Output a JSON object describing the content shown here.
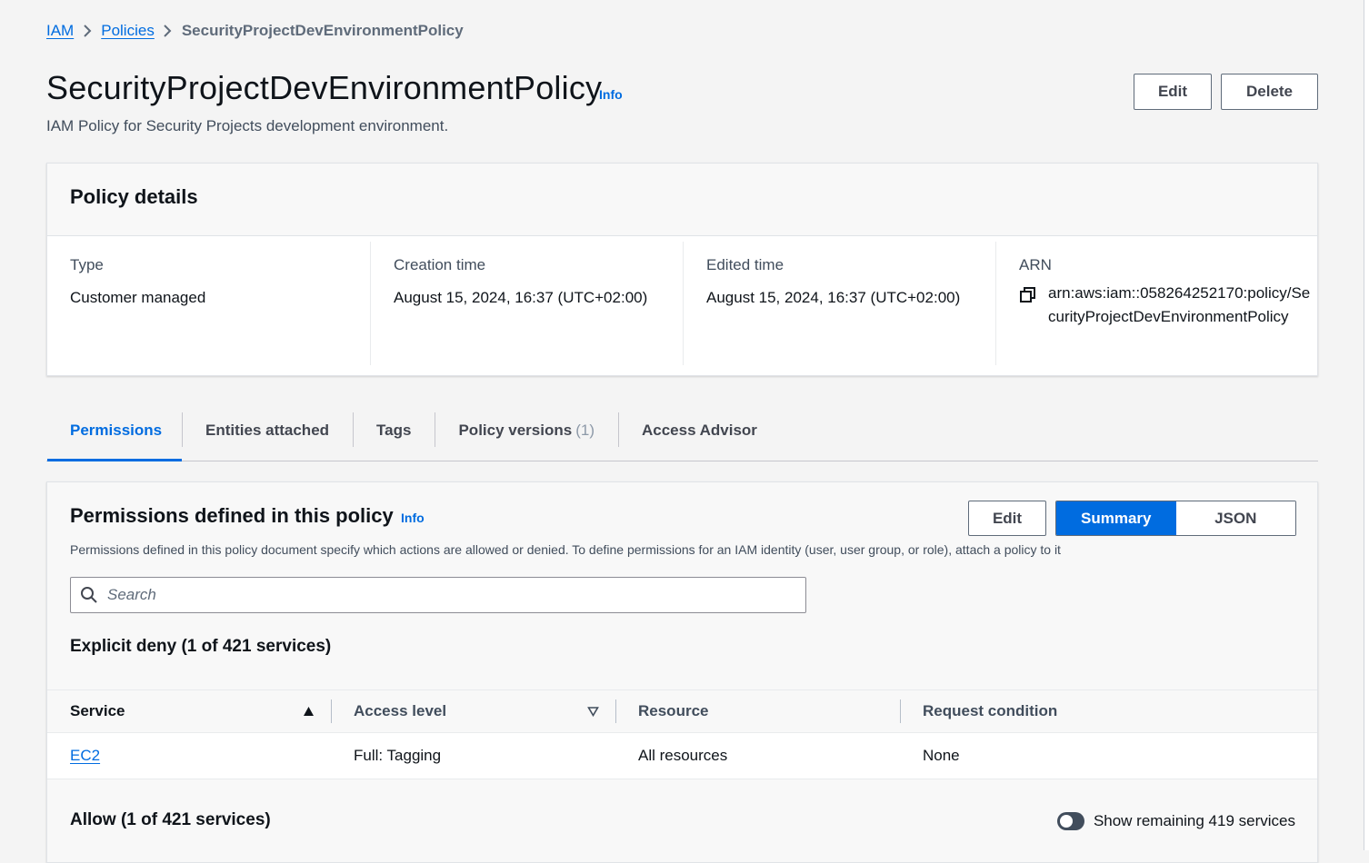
{
  "breadcrumb": {
    "items": [
      "IAM",
      "Policies"
    ],
    "current": "SecurityProjectDevEnvironmentPolicy"
  },
  "header": {
    "title": "SecurityProjectDevEnvironmentPolicy",
    "info": "Info",
    "description": "IAM Policy for Security Projects development environment.",
    "edit_label": "Edit",
    "delete_label": "Delete"
  },
  "details": {
    "title": "Policy details",
    "type_label": "Type",
    "type_value": "Customer managed",
    "creation_label": "Creation time",
    "creation_value": "August 15, 2024, 16:37 (UTC+02:00)",
    "edited_label": "Edited time",
    "edited_value": "August 15, 2024, 16:37 (UTC+02:00)",
    "arn_label": "ARN",
    "arn_value": "arn:aws:iam::058264252170:policy/SecurityProjectDevEnvironmentPolicy"
  },
  "tabs": {
    "permissions": "Permissions",
    "entities": "Entities attached",
    "tags": "Tags",
    "versions": "Policy versions",
    "versions_count": "(1)",
    "advisor": "Access Advisor"
  },
  "permissions": {
    "title": "Permissions defined in this policy",
    "info": "Info",
    "description": "Permissions defined in this policy document specify which actions are allowed or denied. To define permissions for an IAM identity (user, user group, or role), attach a policy to it",
    "edit_label": "Edit",
    "summary_label": "Summary",
    "json_label": "JSON",
    "search_placeholder": "Search",
    "deny_heading": "Explicit deny (1 of 421 services)",
    "columns": [
      "Service",
      "Access level",
      "Resource",
      "Request condition"
    ],
    "rows": [
      {
        "service": "EC2",
        "access": "Full: Tagging",
        "resource": "All resources",
        "condition": "None"
      }
    ],
    "allow_heading": "Allow (1 of 421 services)",
    "toggle_label": "Show remaining 419 services"
  },
  "colors": {
    "accent": "#006ce0",
    "text": "#0f141a",
    "muted": "#414d5c"
  }
}
